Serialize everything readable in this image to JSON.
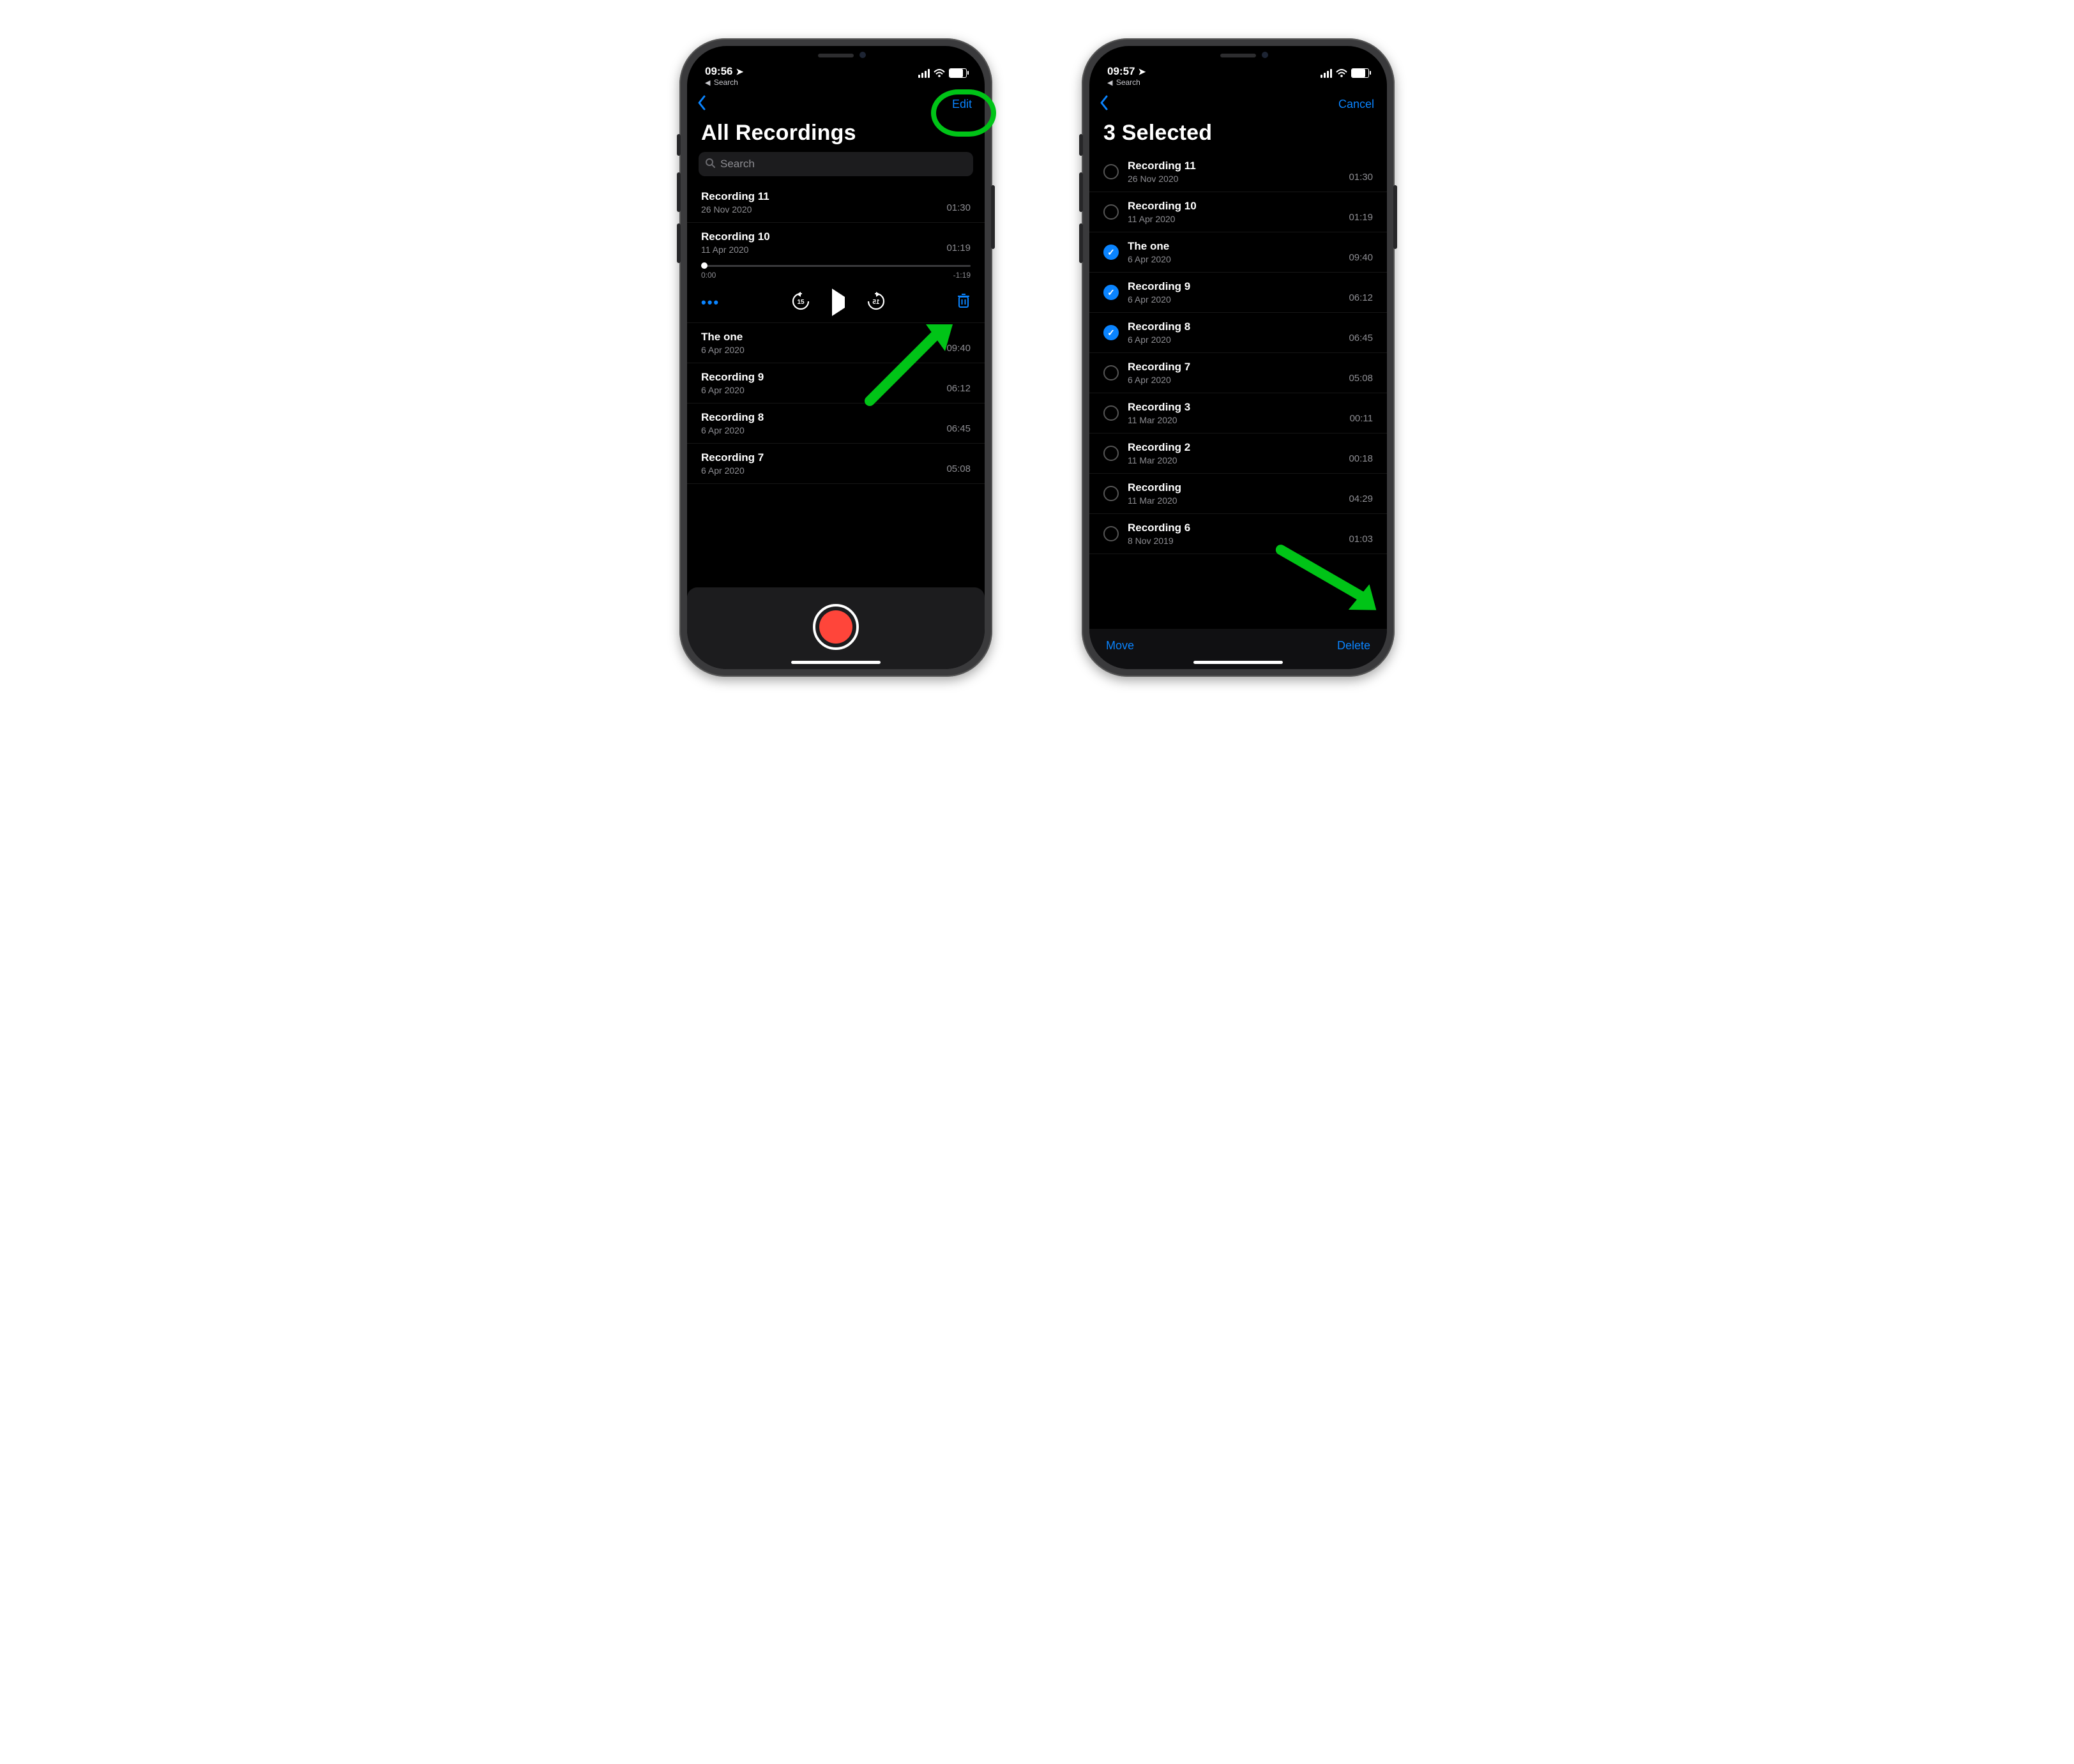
{
  "colors": {
    "accent": "#0a84ff",
    "annotate": "#00c417",
    "record": "#ff453a"
  },
  "left": {
    "status": {
      "time": "09:56",
      "back_crumb": "Search"
    },
    "nav": {
      "edit": "Edit"
    },
    "title": "All Recordings",
    "search": {
      "placeholder": "Search"
    },
    "rows_top": [
      {
        "name": "Recording 11",
        "date": "26 Nov 2020",
        "dur": "01:30"
      }
    ],
    "expanded": {
      "name": "Recording 10",
      "date": "11 Apr 2020",
      "dur": "01:19",
      "t_start": "0:00",
      "t_end": "-1:19",
      "icons": {
        "more": "more-icon",
        "back15": "skip-back-15-icon",
        "play": "play-icon",
        "fwd15": "skip-forward-15-icon",
        "trash": "trash-icon"
      }
    },
    "rows_bottom": [
      {
        "name": "The one",
        "date": "6 Apr 2020",
        "dur": "09:40"
      },
      {
        "name": "Recording 9",
        "date": "6 Apr 2020",
        "dur": "06:12"
      },
      {
        "name": "Recording 8",
        "date": "6 Apr 2020",
        "dur": "06:45"
      },
      {
        "name": "Recording 7",
        "date": "6 Apr 2020",
        "dur": "05:08"
      }
    ]
  },
  "right": {
    "status": {
      "time": "09:57",
      "back_crumb": "Search"
    },
    "nav": {
      "cancel": "Cancel"
    },
    "title": "3 Selected",
    "rows": [
      {
        "name": "Recording 11",
        "date": "26 Nov 2020",
        "dur": "01:30",
        "sel": false
      },
      {
        "name": "Recording 10",
        "date": "11 Apr 2020",
        "dur": "01:19",
        "sel": false
      },
      {
        "name": "The one",
        "date": "6 Apr 2020",
        "dur": "09:40",
        "sel": true
      },
      {
        "name": "Recording 9",
        "date": "6 Apr 2020",
        "dur": "06:12",
        "sel": true
      },
      {
        "name": "Recording 8",
        "date": "6 Apr 2020",
        "dur": "06:45",
        "sel": true
      },
      {
        "name": "Recording 7",
        "date": "6 Apr 2020",
        "dur": "05:08",
        "sel": false
      },
      {
        "name": "Recording 3",
        "date": "11 Mar 2020",
        "dur": "00:11",
        "sel": false
      },
      {
        "name": "Recording 2",
        "date": "11 Mar 2020",
        "dur": "00:18",
        "sel": false
      },
      {
        "name": "Recording",
        "date": "11 Mar 2020",
        "dur": "04:29",
        "sel": false
      },
      {
        "name": "Recording 6",
        "date": "8 Nov 2019",
        "dur": "01:03",
        "sel": false
      }
    ],
    "toolbar": {
      "move": "Move",
      "delete": "Delete"
    }
  }
}
